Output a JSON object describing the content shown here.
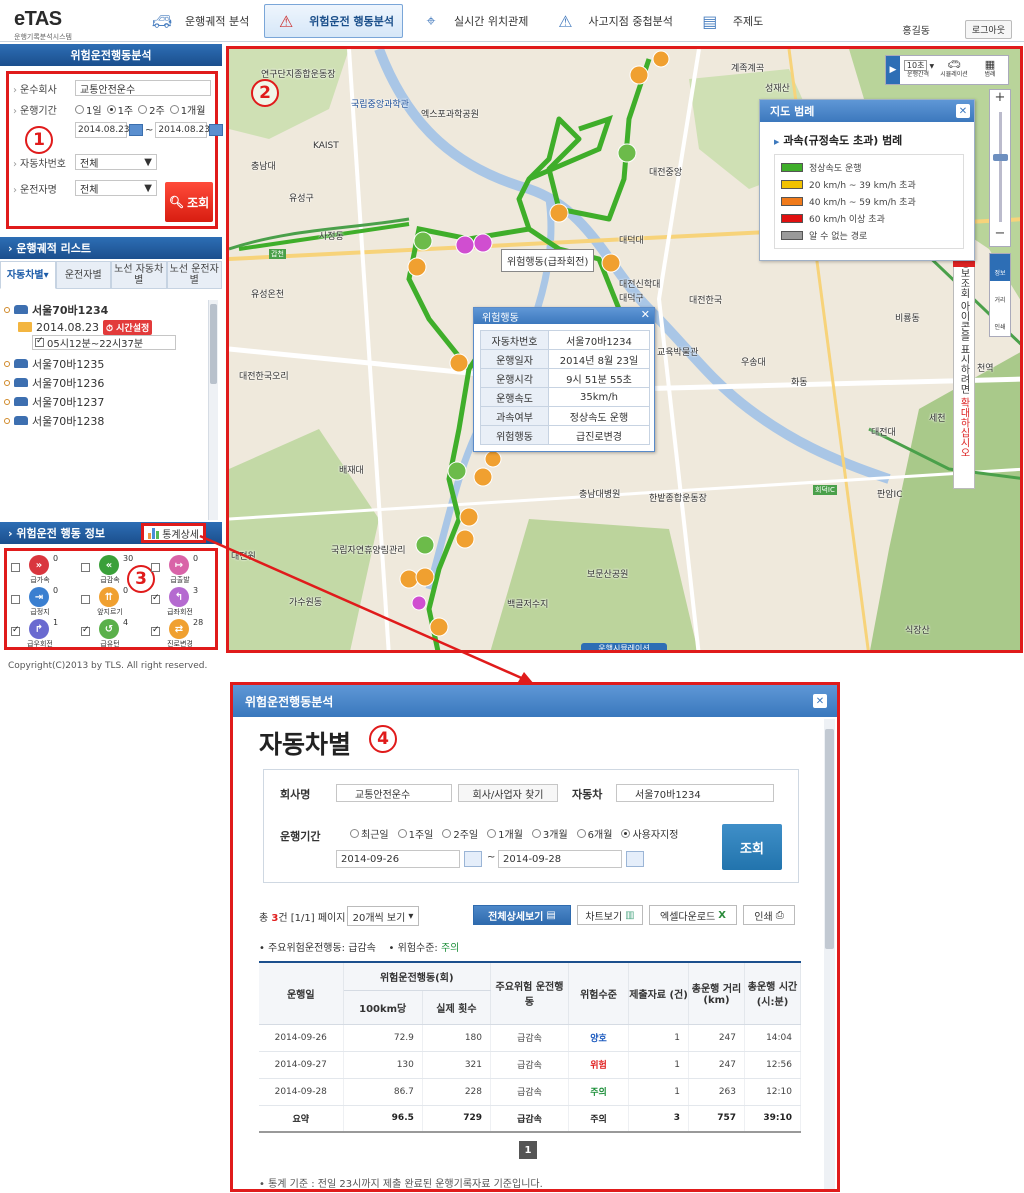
{
  "header": {
    "logo": "eTAS",
    "logo_sub": "운행기록분석시스템",
    "nav": [
      {
        "label": "운행궤적 분석",
        "icon": "car-route-icon",
        "active": false
      },
      {
        "label": "위험운전 행동분석",
        "icon": "car-warning-icon",
        "active": true
      },
      {
        "label": "실시간 위치관제",
        "icon": "location-map-icon",
        "active": false
      },
      {
        "label": "사고지점 중첩분석",
        "icon": "accident-map-icon",
        "active": false
      },
      {
        "label": "주제도",
        "icon": "layer-map-icon",
        "active": false
      }
    ],
    "user": "홍길동",
    "logout": "로그아웃"
  },
  "left": {
    "title": "위험운전행동분석",
    "company_label": "운수회사",
    "company_value": "교통안전운수",
    "period_label": "운행기간",
    "period_options": [
      "1일",
      "1주",
      "2주",
      "1개월"
    ],
    "period_selected": "1주",
    "date_from": "2014.08.23",
    "date_sep": "~",
    "date_to": "2014.08.23",
    "vehicle_label": "자동차번호",
    "vehicle_value": "전체",
    "driver_label": "운전자명",
    "driver_value": "전체",
    "query_button": "조회",
    "list_title": "운행궤적 리스트",
    "tabs": [
      "자동차별▾",
      "운전자별",
      "노선 자동차별",
      "노선 운전자별"
    ],
    "vehicle_selected": "서울70바1234",
    "selected_date": "2014.08.23",
    "time_setting": "시간설정",
    "time_range": "05시12분~22시37분",
    "vehicles": [
      "서울70바1235",
      "서울70바1236",
      "서울70바1237",
      "서울70바1238"
    ],
    "info_title": "위험운전 행동 정보",
    "stats_button": "통계상세",
    "behaviors": [
      {
        "label": "급가속",
        "count": "0",
        "checked": false,
        "color": "#d9363e",
        "icon": "accelerate-icon"
      },
      {
        "label": "급감속",
        "count": "30",
        "checked": false,
        "color": "#3aa03a",
        "icon": "decelerate-icon"
      },
      {
        "label": "급출발",
        "count": "0",
        "checked": false,
        "color": "#d964a8",
        "icon": "sudden-start-icon"
      },
      {
        "label": "급정지",
        "count": "0",
        "checked": false,
        "color": "#3a7fd0",
        "icon": "sudden-stop-icon"
      },
      {
        "label": "앞지르기",
        "count": "0",
        "checked": false,
        "color": "#f0a030",
        "icon": "overtake-icon"
      },
      {
        "label": "급좌회전",
        "count": "3",
        "checked": true,
        "color": "#b56ad0",
        "icon": "left-turn-icon"
      },
      {
        "label": "급우회전",
        "count": "1",
        "checked": true,
        "color": "#6a6ad0",
        "icon": "right-turn-icon"
      },
      {
        "label": "급유턴",
        "count": "4",
        "checked": true,
        "color": "#5ab04a",
        "icon": "u-turn-icon"
      },
      {
        "label": "진로변경",
        "count": "28",
        "checked": true,
        "color": "#f0a030",
        "icon": "lane-change-icon"
      }
    ]
  },
  "markers": {
    "one": "1",
    "two": "2",
    "three": "3",
    "four": "4"
  },
  "map": {
    "tools": {
      "interval": "10초",
      "interval_label": "운행간격",
      "sim_label": "시뮬레이션",
      "legend_label": "범례"
    },
    "labels": [
      "연구단지종합운동장",
      "계족계곡",
      "성재산",
      "국립중앙과학관",
      "엑스포과학공원",
      "KAIST",
      "충남대",
      "유성구",
      "대전중앙",
      "갑천",
      "대전신학대",
      "대덕구",
      "대전한국",
      "유성온천",
      "대전한국오리",
      "배재대",
      "충남대병원",
      "한밭종합운동장",
      "대전원",
      "국립자연휴양림관리",
      "가수원동",
      "보문산공원",
      "백골저수지",
      "식장산",
      "비룡동",
      "우송대",
      "세천",
      "대전대",
      "판암IC",
      "회덕IC",
      "천역",
      "교육박물관",
      "화동",
      "사정동",
      "대덕대"
    ],
    "side_tools": [
      "정보",
      "거리",
      "인쇄"
    ],
    "vertical_tip_a": "정보조회 아이콘을 표시하려면 ",
    "vertical_tip_b": "확대하십시오",
    "tip_badge": "안내",
    "bottom_tab": "운행시뮬레이션",
    "legend": {
      "title": "지도 범례",
      "subtitle": "과속(규정속도 초과) 범례",
      "rows": [
        {
          "label": "정상속도 운행",
          "color": "#3fae2a"
        },
        {
          "label": "20 km/h ~ 39 km/h 초과",
          "color": "#f2c200"
        },
        {
          "label": "40 km/h ~ 59 km/h 초과",
          "color": "#f07a1a"
        },
        {
          "label": "60 km/h 이상 초과",
          "color": "#e01010"
        },
        {
          "label": "알 수 없는 경로",
          "color": "#9a9a9a"
        }
      ]
    },
    "marker_label": "위험행동(급좌회전)",
    "popup": {
      "title": "위험행동",
      "rows": [
        {
          "k": "자동차번호",
          "v": "서울70바1234"
        },
        {
          "k": "운행일자",
          "v": "2014년 8월 23일"
        },
        {
          "k": "운행시각",
          "v": "9시 51분 55초"
        },
        {
          "k": "운행속도",
          "v": "35km/h"
        },
        {
          "k": "과속여부",
          "v": "정상속도 운행"
        },
        {
          "k": "위험행동",
          "v": "급진로변경"
        }
      ]
    }
  },
  "copyright": "Copyright(C)2013 by TLS. All right reserved.",
  "modal": {
    "head": "위험운전행동분석",
    "title": "자동차별",
    "company_label": "회사명",
    "company_value": "교통안전운수",
    "company_find": "회사/사업자 찾기",
    "vehicle_label": "자동차",
    "vehicle_value": "서울70바1234",
    "period_label": "운행기간",
    "period_options": [
      "최근일",
      "1주일",
      "2주일",
      "1개월",
      "3개월",
      "6개월",
      "사용자지정"
    ],
    "period_selected": "사용자지정",
    "date_from": "2014-09-26",
    "date_sep": "~",
    "date_to": "2014-09-28",
    "query_button": "조회",
    "count_prefix": "총 ",
    "count": "3",
    "count_suffix": "건 [1/1] 페이지",
    "page_size": "20개씩 보기",
    "btn_all": "전체상세보기",
    "btn_chart": "차트보기",
    "btn_excel": "엑셀다운로드",
    "btn_print": "인쇄",
    "main_behavior_label": "• 주요위험운전행동: 급감속",
    "risk_label": "• 위험수준: ",
    "risk_value": "주의",
    "columns": {
      "date": "운행일",
      "behavior_group": "위험운전행동(회)",
      "per100": "100km당",
      "actual": "실제 횟수",
      "main": "주요위험 운전행동",
      "level": "위험수준",
      "submitted": "제출자료 (건)",
      "distance": "총운행 거리 (km)",
      "time": "총운행 시간 (시:분)"
    },
    "rows": [
      {
        "date": "2014-09-26",
        "per100": "72.9",
        "actual": "180",
        "main": "급감속",
        "level": "양호",
        "level_class": "good",
        "submitted": "1",
        "distance": "247",
        "time": "14:04"
      },
      {
        "date": "2014-09-27",
        "per100": "130",
        "actual": "321",
        "main": "급감속",
        "level": "위험",
        "level_class": "danger",
        "submitted": "1",
        "distance": "247",
        "time": "12:56"
      },
      {
        "date": "2014-09-28",
        "per100": "86.7",
        "actual": "228",
        "main": "급감속",
        "level": "주의",
        "level_class": "warn",
        "submitted": "1",
        "distance": "263",
        "time": "12:10"
      }
    ],
    "total": {
      "date": "요약",
      "per100": "96.5",
      "actual": "729",
      "main": "급감속",
      "level": "주의",
      "level_class": "warn",
      "submitted": "3",
      "distance": "757",
      "time": "39:10"
    },
    "page": "1",
    "note": "• 통계 기준 : 전일 23시까지 제출 완료된 운행기록자료 기준입니다."
  }
}
